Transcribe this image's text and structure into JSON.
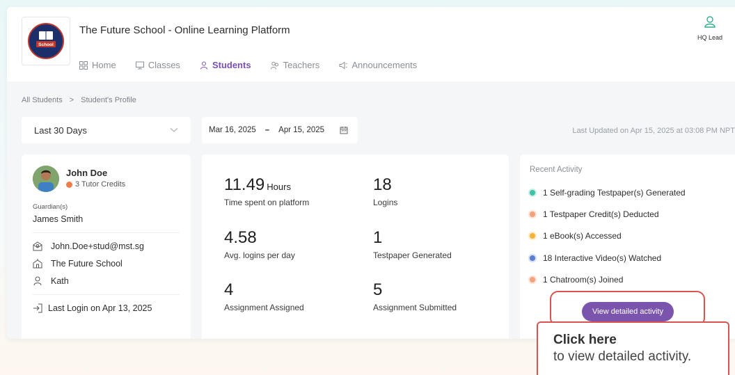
{
  "header": {
    "app_title": "The Future School - Online Learning Platform",
    "logo_text": "School",
    "nav": [
      {
        "label": "Home",
        "icon": "grid-icon"
      },
      {
        "label": "Classes",
        "icon": "monitor-icon"
      },
      {
        "label": "Students",
        "icon": "student-icon",
        "active": true
      },
      {
        "label": "Teachers",
        "icon": "teachers-icon"
      },
      {
        "label": "Announcements",
        "icon": "megaphone-icon"
      }
    ],
    "user_label": "HQ Lead"
  },
  "breadcrumb": {
    "root": "All Students",
    "separator": ">",
    "current": "Student's Profile"
  },
  "filters": {
    "range_label": "Last 30 Days",
    "start_date": "Mar 16, 2025",
    "dash": "–",
    "end_date": "Apr 15, 2025",
    "last_updated": "Last Updated on Apr 15, 2025 at 03:08 PM NPT"
  },
  "profile": {
    "name": "John Doe",
    "credits": "3 Tutor Credits",
    "guardian_label": "Guardian(s)",
    "guardian_name": "James Smith",
    "email": "John.Doe+stud@mst.sg",
    "school": "The Future School",
    "teacher": "Kath",
    "last_login": "Last Login on Apr 13, 2025"
  },
  "stats": {
    "time_value": "11.49",
    "time_unit": "Hours",
    "time_label": "Time spent on platform",
    "logins_value": "18",
    "logins_label": "Logins",
    "avg_value": "4.58",
    "avg_label": "Avg. logins per day",
    "testpaper_value": "1",
    "testpaper_label": "Testpaper Generated",
    "assigned_value": "4",
    "assigned_label": "Assignment Assigned",
    "submitted_value": "5",
    "submitted_label": "Assignment Submitted"
  },
  "activity": {
    "title": "Recent Activity",
    "items": [
      {
        "text": "1 Self-grading Testpaper(s) Generated",
        "color": "#3cc2a5"
      },
      {
        "text": "1 Testpaper Credit(s) Deducted",
        "color": "#f4a17c"
      },
      {
        "text": "1 eBook(s) Accessed",
        "color": "#f6b13c"
      },
      {
        "text": "18 Interactive Video(s) Watched",
        "color": "#5b7fd1"
      },
      {
        "text": "1 Chatroom(s) Joined",
        "color": "#f4a17c"
      }
    ],
    "button_label": "View detailed activity"
  },
  "callout": {
    "title": "Click here",
    "body": "to view detailed activity."
  }
}
